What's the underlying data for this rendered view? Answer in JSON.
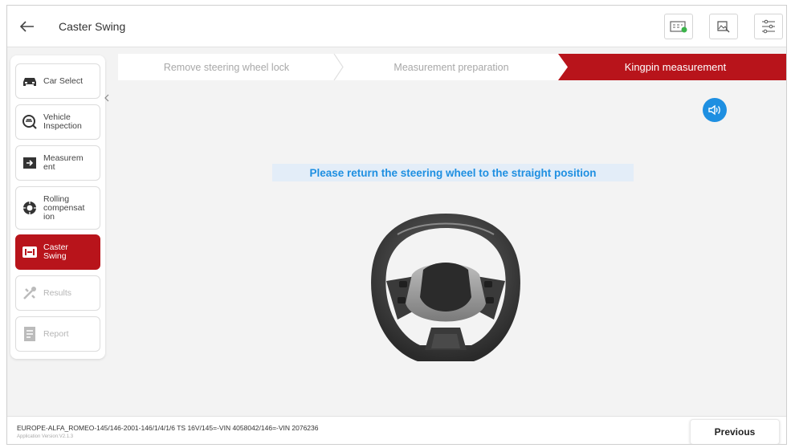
{
  "header": {
    "title": "Caster Swing",
    "icons": [
      "back-arrow-icon",
      "device-connected-icon",
      "report-image-icon",
      "settings-sliders-icon"
    ]
  },
  "sidebar": {
    "items": [
      {
        "label": "Car Select",
        "icon": "car-icon",
        "state": "normal"
      },
      {
        "label": "Vehicle Inspection",
        "icon": "inspection-icon",
        "state": "normal"
      },
      {
        "label": "Measurement",
        "icon": "measurement-icon",
        "state": "normal"
      },
      {
        "label": "Rolling compensation",
        "icon": "rolling-wheel-icon",
        "state": "normal"
      },
      {
        "label": "Caster Swing",
        "icon": "caster-icon",
        "state": "active"
      },
      {
        "label": "Results",
        "icon": "results-icon",
        "state": "disabled"
      },
      {
        "label": "Report",
        "icon": "report-icon",
        "state": "disabled"
      }
    ],
    "labels_display": [
      "Car Select",
      "Vehicle\nInspection",
      "Measurem\nent",
      "Rolling\ncompensat\nion",
      "Caster\nSwing",
      "Results",
      "Report"
    ]
  },
  "steps": [
    {
      "label": "Remove steering wheel lock",
      "state": "done"
    },
    {
      "label": "Measurement preparation",
      "state": "done"
    },
    {
      "label": "Kingpin measurement",
      "state": "active"
    }
  ],
  "main": {
    "instruction": "Please return the steering wheel to the straight position",
    "image": "steering-wheel"
  },
  "footer": {
    "vehicle": "EUROPE-ALFA_ROMEO-145/146-2001-146/1/4/1/6 TS 16V/145=-VIN 4058042/146=-VIN 2076236",
    "version": "Application Version:V2.1.3",
    "previous_label": "Previous"
  },
  "colors": {
    "accent": "#b8141b",
    "info_blue": "#1e8fe1",
    "background": "#f3f3f3"
  }
}
